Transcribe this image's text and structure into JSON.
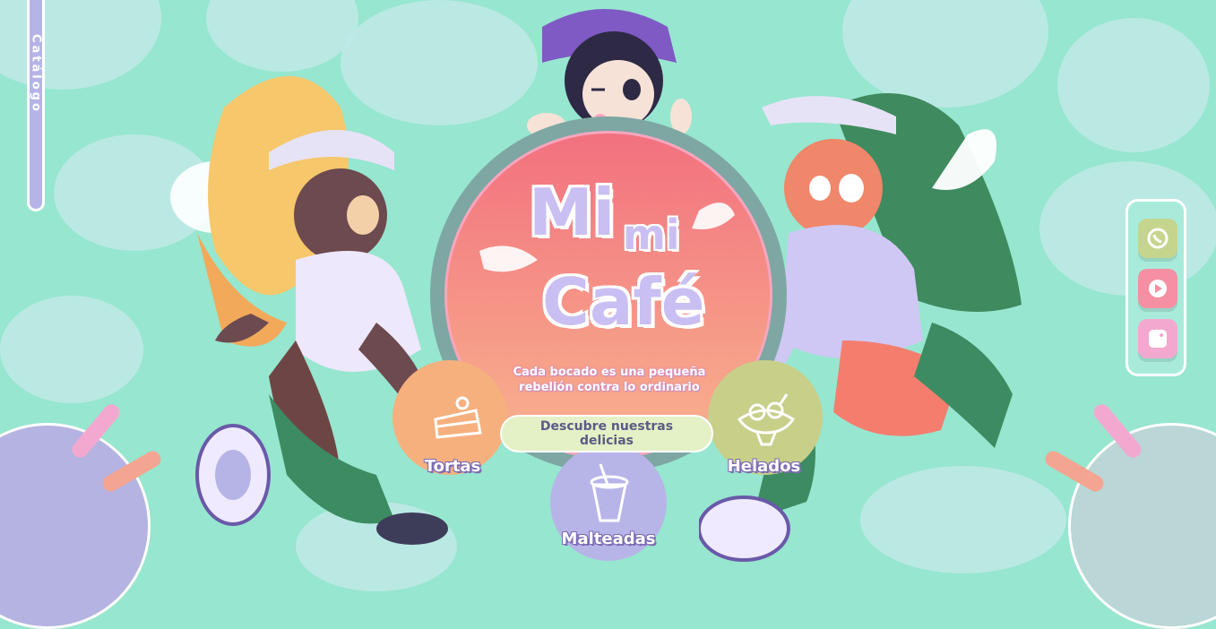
{
  "side_tab": {
    "label": "Catálogo"
  },
  "logo": {
    "line1": "Mi",
    "line2": "mi",
    "line3": "Café"
  },
  "tagline": {
    "line1": "Cada bocado es una pequeña",
    "line2": "rebelión contra lo ordinario"
  },
  "cta": {
    "line1": "Descubre nuestras",
    "line2": "delicias"
  },
  "categories": [
    {
      "label": "Tortas",
      "icon": "cake-icon",
      "color": "#f6b07e"
    },
    {
      "label": "Malteadas",
      "icon": "milkshake-icon",
      "color": "#b7b5e8"
    },
    {
      "label": "Helados",
      "icon": "ice-cream-icon",
      "color": "#c8cf89"
    }
  ],
  "social": [
    {
      "icon": "whatsapp-icon",
      "color": "#c5d58e"
    },
    {
      "icon": "youtube-icon",
      "color": "#f58fa3"
    },
    {
      "icon": "instagram-icon",
      "color": "#f3a9cf"
    }
  ],
  "colors": {
    "background": "#97e6cf",
    "blob": "#bfe9e6",
    "accent_lavender": "#b6b4e6",
    "circle_top": "#f2717f",
    "circle_bottom": "#f9b38e"
  }
}
